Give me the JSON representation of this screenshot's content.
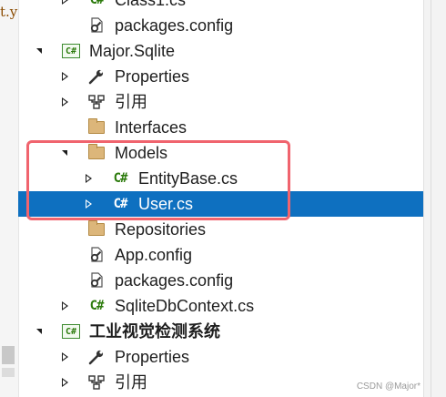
{
  "left_fragment": "t.y",
  "tree": [
    {
      "label": "Class1.cs",
      "icon": "csharp-file-icon",
      "expander": "collapsed",
      "name": "class1-cs"
    },
    {
      "label": "packages.config",
      "icon": "config-file-icon",
      "expander": "none",
      "name": "packages-config-1"
    },
    {
      "label": "Major.Sqlite",
      "icon": "csharp-project-icon",
      "expander": "expanded",
      "name": "project-major-sqlite"
    },
    {
      "label": "Properties",
      "icon": "wrench-icon",
      "expander": "collapsed",
      "name": "properties-1"
    },
    {
      "label": "引用",
      "icon": "references-icon",
      "expander": "collapsed",
      "name": "references-1"
    },
    {
      "label": "Interfaces",
      "icon": "folder-icon",
      "expander": "none",
      "name": "folder-interfaces"
    },
    {
      "label": "Models",
      "icon": "folder-icon",
      "expander": "expanded",
      "name": "folder-models"
    },
    {
      "label": "EntityBase.cs",
      "icon": "csharp-file-icon",
      "expander": "collapsed",
      "name": "entitybase-cs"
    },
    {
      "label": "User.cs",
      "icon": "csharp-file-icon",
      "expander": "collapsed",
      "selected": true,
      "name": "user-cs"
    },
    {
      "label": "Repositories",
      "icon": "folder-icon",
      "expander": "none",
      "name": "folder-repositories"
    },
    {
      "label": "App.config",
      "icon": "config-file-icon",
      "expander": "none",
      "name": "app-config"
    },
    {
      "label": "packages.config",
      "icon": "config-file-icon",
      "expander": "none",
      "name": "packages-config-2"
    },
    {
      "label": "SqliteDbContext.cs",
      "icon": "csharp-file-icon",
      "expander": "collapsed",
      "name": "sqlitedbcontext-cs"
    },
    {
      "label": "工业视觉检测系统",
      "icon": "csharp-project-icon",
      "expander": "expanded",
      "bold": true,
      "name": "project-industrial-vision"
    },
    {
      "label": "Properties",
      "icon": "wrench-icon",
      "expander": "collapsed",
      "name": "properties-2"
    },
    {
      "label": "引用",
      "icon": "references-icon",
      "expander": "collapsed",
      "name": "references-2"
    }
  ],
  "colors": {
    "selection": "#0e70c0",
    "highlight_box": "#f0646e",
    "csharp_icon": "#2b7a0b",
    "folder": "#dcb67a"
  },
  "watermark": "CSDN @Major*"
}
